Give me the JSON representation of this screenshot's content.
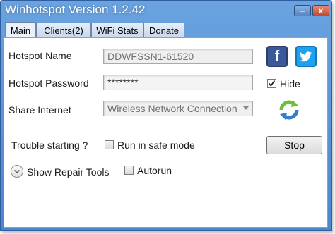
{
  "window": {
    "title": "Winhotspot Version 1.2.42",
    "minimize_label": "–",
    "close_label": "x"
  },
  "tabs": [
    {
      "label": "Main",
      "active": true
    },
    {
      "label": "Clients(2)",
      "active": false
    },
    {
      "label": "WiFi Stats",
      "active": false
    },
    {
      "label": "Donate",
      "active": false
    }
  ],
  "main": {
    "hotspot_name_label": "Hotspot Name",
    "hotspot_name_value": "DDWFSSN1-61520",
    "hotspot_password_label": "Hotspot Password",
    "hotspot_password_value": "********",
    "hide_label": "Hide",
    "hide_checked": true,
    "share_internet_label": "Share Internet",
    "share_internet_value": "Wireless Network Connection",
    "trouble_label": "Trouble starting ?",
    "safe_mode_label": "Run in safe mode",
    "safe_mode_checked": false,
    "stop_label": "Stop",
    "repair_label": "Show Repair Tools",
    "autorun_label": "Autorun",
    "autorun_checked": false
  },
  "icons": {
    "facebook": "facebook-icon",
    "twitter": "twitter-icon",
    "refresh": "refresh-icon",
    "expand": "chevron-down-icon"
  },
  "colors": {
    "titlebar": "#5b93d8",
    "facebook": "#3b5998",
    "twitter": "#1da1f2",
    "refresh_green": "#6bbf3a",
    "refresh_blue": "#2f7fd0"
  }
}
